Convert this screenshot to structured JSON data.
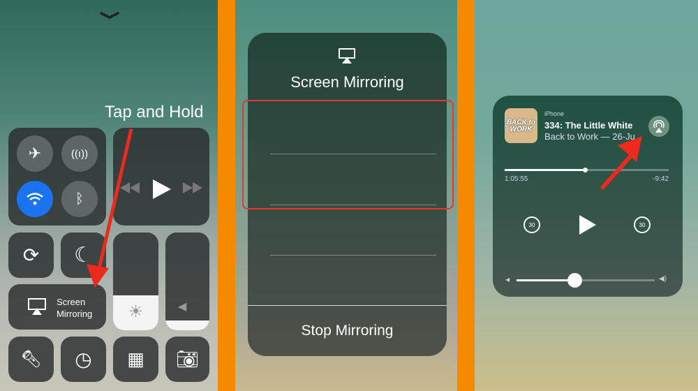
{
  "panel1": {
    "annotation": "Tap and Hold",
    "connectivity": [
      "airplane-mode",
      "cellular-data",
      "wifi",
      "bluetooth"
    ],
    "screen_mirroring_label_1": "Screen",
    "screen_mirroring_label_2": "Mirroring",
    "brightness_level": 0.36,
    "volume_level": 0.1,
    "colors": {
      "wifi_active": "#1a73f0",
      "arrow": "#ee2a1d"
    }
  },
  "panel2": {
    "title": "Screen Mirroring",
    "stop_label": "Stop Mirroring"
  },
  "panel3": {
    "source": "iPhone",
    "track_title": "334: The Little White",
    "track_subtitle": "Back to Work — 26-Ju",
    "artwork_text_1": "BACK to",
    "artwork_text_2": "WORK",
    "elapsed": "1:05:55",
    "remaining": "-9:42",
    "progress": 0.49,
    "volume": 0.42,
    "skip_back_label": "30",
    "skip_fwd_label": "30"
  },
  "frame_color": "#f38a00"
}
